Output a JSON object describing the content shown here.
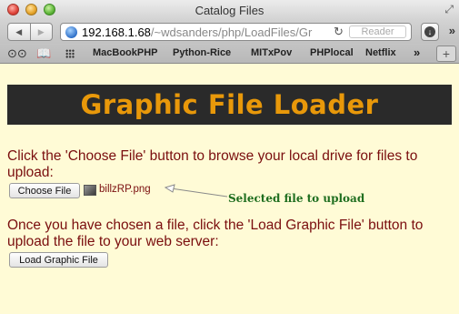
{
  "window": {
    "title": "Catalog Files"
  },
  "toolbar": {
    "back_icon": "back-arrow-icon",
    "forward_icon": "forward-arrow-icon",
    "url_host": "192.168.1.68",
    "url_path": "/~wdsanders/php/LoadFiles/Gr",
    "reader_label": "Reader"
  },
  "bookmarks": {
    "items": [
      "MacBookPHP",
      "Python-Rice",
      "MITxPov",
      "PHPlocal",
      "Netflix"
    ],
    "more": "»",
    "add": "+"
  },
  "page": {
    "banner_title": "Graphic File Loader",
    "intro_text": "Click the 'Choose File' button to browse your local drive for files to upload:",
    "choose_button_label": "Choose File",
    "selected_file_name": "billzRP.png",
    "annotation_text": "Selected file to upload",
    "instruction_text": "Once you have chosen a file, click the 'Load Graphic File' button to upload the file to your web server:",
    "load_button_label": "Load Graphic File"
  },
  "colors": {
    "page_background": "#fffbd6",
    "banner_background": "#2a2a2a",
    "banner_text": "#e8980a",
    "body_text": "#7a0e0e",
    "annotation_text": "#1f6e1f"
  }
}
